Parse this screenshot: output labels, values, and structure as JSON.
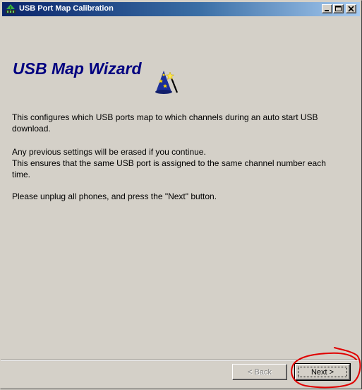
{
  "window": {
    "title": "USB Port Map Calibration",
    "controls": [
      "minimize",
      "maximize",
      "close"
    ]
  },
  "wizard": {
    "heading": "USB Map Wizard",
    "icon": "wizard-hat-icon",
    "paragraphs": [
      "This configures which USB ports map to which channels during an auto start USB download.",
      "Any previous settings will be erased if you continue.",
      "This ensures that the same USB port is assigned to the same channel number each time.",
      "Please unplug all phones, and press the \"Next\" button."
    ]
  },
  "buttons": {
    "back": {
      "label": "< Back",
      "enabled": false
    },
    "next": {
      "label": "Next >",
      "enabled": true,
      "focused": true
    }
  },
  "colors": {
    "titlebar_start": "#0a246a",
    "titlebar_end": "#a6caf0",
    "heading": "#000080",
    "annotation": "#e00000",
    "face": "#d4d0c8"
  }
}
